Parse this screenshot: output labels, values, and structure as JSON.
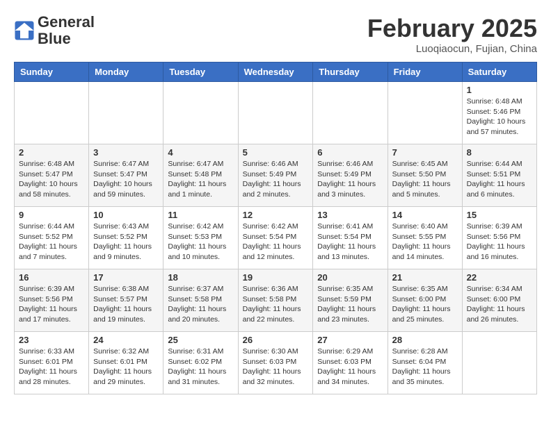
{
  "logo": {
    "line1": "General",
    "line2": "Blue"
  },
  "title": "February 2025",
  "subtitle": "Luoqiaocun, Fujian, China",
  "days_of_week": [
    "Sunday",
    "Monday",
    "Tuesday",
    "Wednesday",
    "Thursday",
    "Friday",
    "Saturday"
  ],
  "weeks": [
    [
      {
        "day": "",
        "info": ""
      },
      {
        "day": "",
        "info": ""
      },
      {
        "day": "",
        "info": ""
      },
      {
        "day": "",
        "info": ""
      },
      {
        "day": "",
        "info": ""
      },
      {
        "day": "",
        "info": ""
      },
      {
        "day": "1",
        "info": "Sunrise: 6:48 AM\nSunset: 5:46 PM\nDaylight: 10 hours\nand 57 minutes."
      }
    ],
    [
      {
        "day": "2",
        "info": "Sunrise: 6:48 AM\nSunset: 5:47 PM\nDaylight: 10 hours\nand 58 minutes."
      },
      {
        "day": "3",
        "info": "Sunrise: 6:47 AM\nSunset: 5:47 PM\nDaylight: 10 hours\nand 59 minutes."
      },
      {
        "day": "4",
        "info": "Sunrise: 6:47 AM\nSunset: 5:48 PM\nDaylight: 11 hours\nand 1 minute."
      },
      {
        "day": "5",
        "info": "Sunrise: 6:46 AM\nSunset: 5:49 PM\nDaylight: 11 hours\nand 2 minutes."
      },
      {
        "day": "6",
        "info": "Sunrise: 6:46 AM\nSunset: 5:49 PM\nDaylight: 11 hours\nand 3 minutes."
      },
      {
        "day": "7",
        "info": "Sunrise: 6:45 AM\nSunset: 5:50 PM\nDaylight: 11 hours\nand 5 minutes."
      },
      {
        "day": "8",
        "info": "Sunrise: 6:44 AM\nSunset: 5:51 PM\nDaylight: 11 hours\nand 6 minutes."
      }
    ],
    [
      {
        "day": "9",
        "info": "Sunrise: 6:44 AM\nSunset: 5:52 PM\nDaylight: 11 hours\nand 7 minutes."
      },
      {
        "day": "10",
        "info": "Sunrise: 6:43 AM\nSunset: 5:52 PM\nDaylight: 11 hours\nand 9 minutes."
      },
      {
        "day": "11",
        "info": "Sunrise: 6:42 AM\nSunset: 5:53 PM\nDaylight: 11 hours\nand 10 minutes."
      },
      {
        "day": "12",
        "info": "Sunrise: 6:42 AM\nSunset: 5:54 PM\nDaylight: 11 hours\nand 12 minutes."
      },
      {
        "day": "13",
        "info": "Sunrise: 6:41 AM\nSunset: 5:54 PM\nDaylight: 11 hours\nand 13 minutes."
      },
      {
        "day": "14",
        "info": "Sunrise: 6:40 AM\nSunset: 5:55 PM\nDaylight: 11 hours\nand 14 minutes."
      },
      {
        "day": "15",
        "info": "Sunrise: 6:39 AM\nSunset: 5:56 PM\nDaylight: 11 hours\nand 16 minutes."
      }
    ],
    [
      {
        "day": "16",
        "info": "Sunrise: 6:39 AM\nSunset: 5:56 PM\nDaylight: 11 hours\nand 17 minutes."
      },
      {
        "day": "17",
        "info": "Sunrise: 6:38 AM\nSunset: 5:57 PM\nDaylight: 11 hours\nand 19 minutes."
      },
      {
        "day": "18",
        "info": "Sunrise: 6:37 AM\nSunset: 5:58 PM\nDaylight: 11 hours\nand 20 minutes."
      },
      {
        "day": "19",
        "info": "Sunrise: 6:36 AM\nSunset: 5:58 PM\nDaylight: 11 hours\nand 22 minutes."
      },
      {
        "day": "20",
        "info": "Sunrise: 6:35 AM\nSunset: 5:59 PM\nDaylight: 11 hours\nand 23 minutes."
      },
      {
        "day": "21",
        "info": "Sunrise: 6:35 AM\nSunset: 6:00 PM\nDaylight: 11 hours\nand 25 minutes."
      },
      {
        "day": "22",
        "info": "Sunrise: 6:34 AM\nSunset: 6:00 PM\nDaylight: 11 hours\nand 26 minutes."
      }
    ],
    [
      {
        "day": "23",
        "info": "Sunrise: 6:33 AM\nSunset: 6:01 PM\nDaylight: 11 hours\nand 28 minutes."
      },
      {
        "day": "24",
        "info": "Sunrise: 6:32 AM\nSunset: 6:01 PM\nDaylight: 11 hours\nand 29 minutes."
      },
      {
        "day": "25",
        "info": "Sunrise: 6:31 AM\nSunset: 6:02 PM\nDaylight: 11 hours\nand 31 minutes."
      },
      {
        "day": "26",
        "info": "Sunrise: 6:30 AM\nSunset: 6:03 PM\nDaylight: 11 hours\nand 32 minutes."
      },
      {
        "day": "27",
        "info": "Sunrise: 6:29 AM\nSunset: 6:03 PM\nDaylight: 11 hours\nand 34 minutes."
      },
      {
        "day": "28",
        "info": "Sunrise: 6:28 AM\nSunset: 6:04 PM\nDaylight: 11 hours\nand 35 minutes."
      },
      {
        "day": "",
        "info": ""
      }
    ]
  ]
}
